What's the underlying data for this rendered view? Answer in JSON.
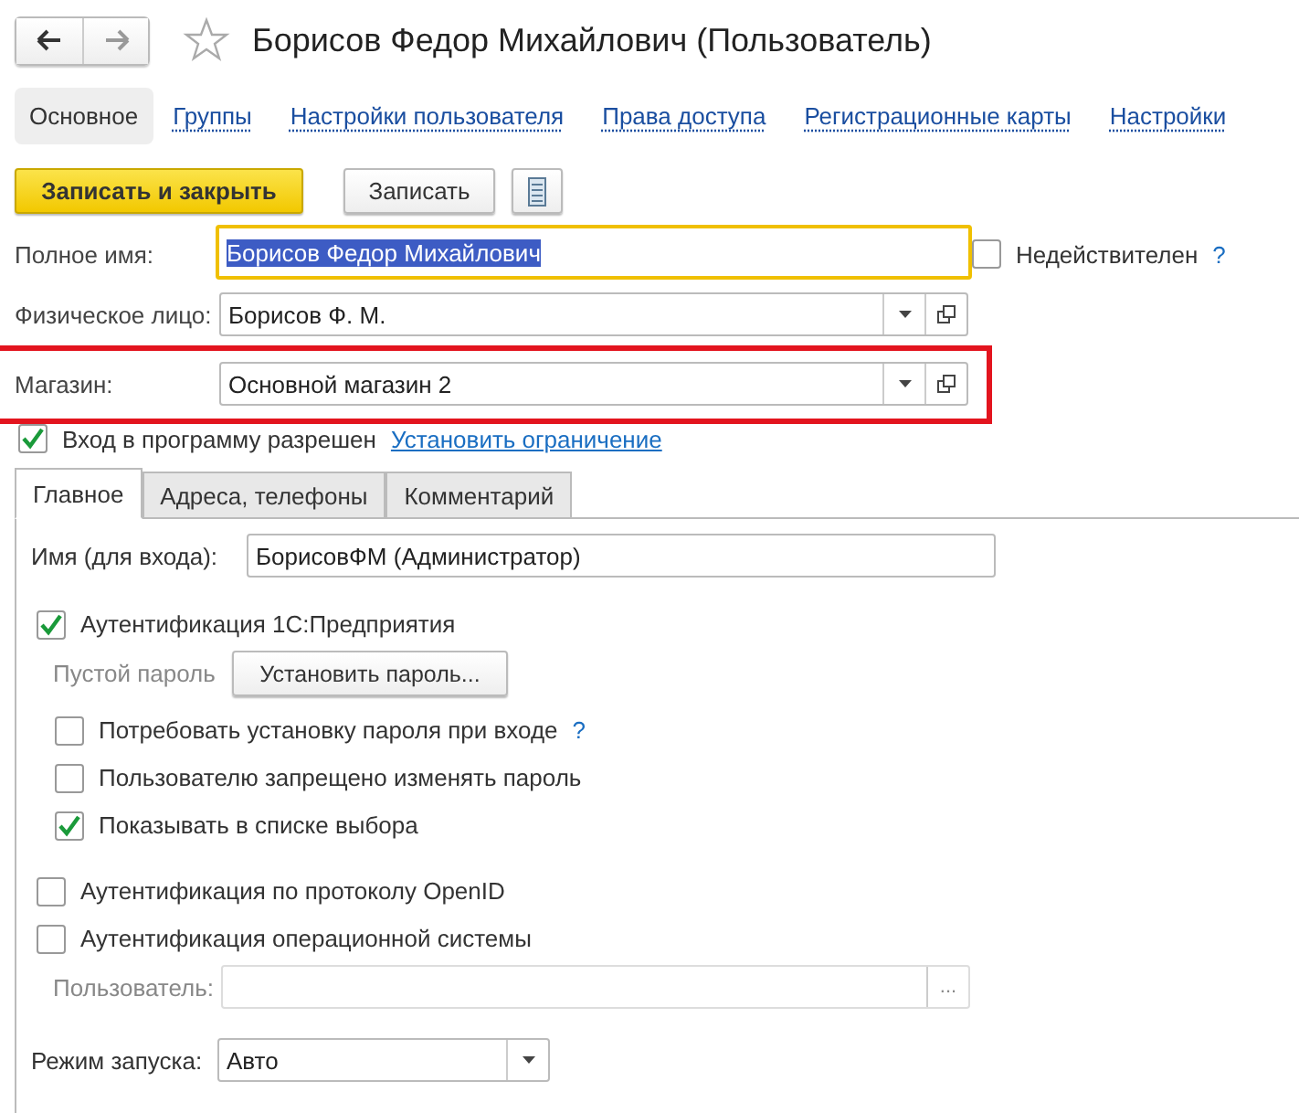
{
  "header": {
    "title": "Борисов Федор Михайлович (Пользователь)",
    "favorite": false
  },
  "nav": [
    {
      "label": "Основное",
      "selected": true
    },
    {
      "label": "Группы",
      "selected": false
    },
    {
      "label": "Настройки пользователя",
      "selected": false
    },
    {
      "label": "Права доступа",
      "selected": false
    },
    {
      "label": "Регистрационные карты",
      "selected": false
    },
    {
      "label": "Настройки",
      "selected": false
    }
  ],
  "toolbar": {
    "primary": "Записать и закрыть",
    "secondary": "Записать"
  },
  "full_name": {
    "label": "Полное имя:",
    "value": "Борисов Федор Михайлович",
    "focused": true
  },
  "invalid": {
    "label": "Недействителен",
    "checked": false,
    "help": "?"
  },
  "person": {
    "label": "Физическое лицо:",
    "value": "Борисов Ф. М.",
    "highlight": false
  },
  "store": {
    "label": "Магазин:",
    "value": "Основной магазин 2",
    "highlight": true
  },
  "login_allowed": {
    "label": "Вход в программу разрешен",
    "checked": true,
    "link": "Установить ограничение"
  },
  "tabs": [
    {
      "label": "Главное",
      "selected": true
    },
    {
      "label": "Адреса, телефоны",
      "selected": false
    },
    {
      "label": "Комментарий",
      "selected": false
    }
  ],
  "login_name": {
    "label": "Имя (для входа):",
    "value": "БорисовФМ (Администратор)"
  },
  "auth_1c": {
    "label": "Аутентификация 1С:Предприятия",
    "checked": true
  },
  "password": {
    "label": "Пустой пароль",
    "button": "Установить пароль..."
  },
  "password_options": [
    {
      "label": "Потребовать установку пароля при входе",
      "checked": false,
      "help": "?"
    },
    {
      "label": "Пользователю запрещено изменять пароль",
      "checked": false
    },
    {
      "label": "Показывать в списке выбора",
      "checked": true
    }
  ],
  "other_auth": [
    {
      "label": "Аутентификация по протоколу OpenID",
      "checked": false
    },
    {
      "label": "Аутентификация операционной системы",
      "checked": false
    }
  ],
  "os_user": {
    "label": "Пользователь:",
    "button": "...",
    "disabled": true
  },
  "launch_mode": {
    "label": "Режим запуска:",
    "value": "Авто"
  }
}
